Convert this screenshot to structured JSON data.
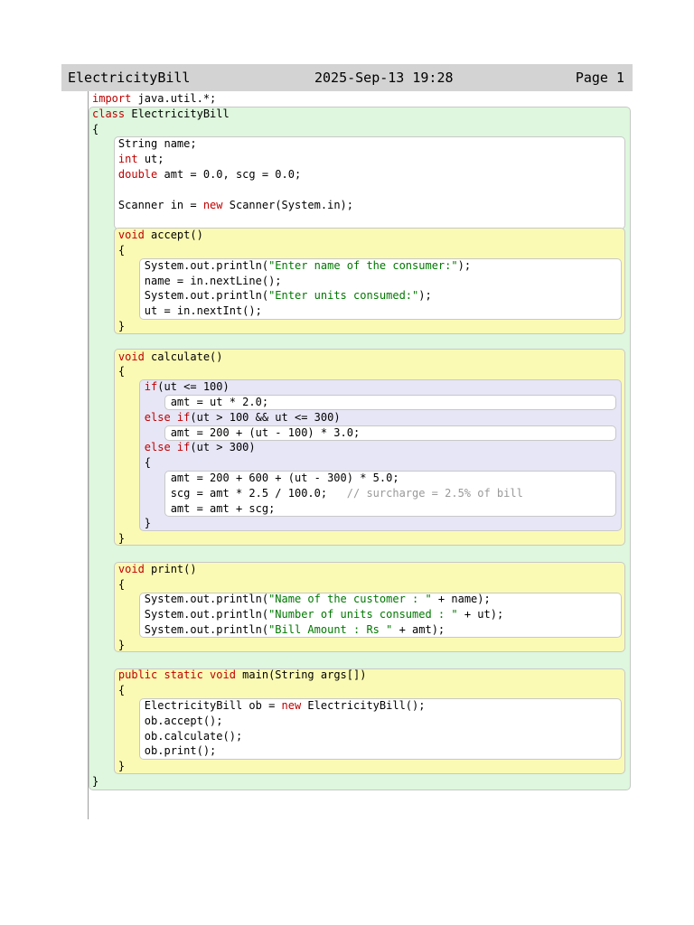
{
  "header": {
    "title": "ElectricityBill",
    "datetime": "2025-Sep-13 19:28",
    "page": "Page 1"
  },
  "code_lines": [
    [
      {
        "t": "import",
        "k": "kw"
      },
      {
        "t": " java.util.*;"
      }
    ],
    [
      {
        "t": "class",
        "k": "kw"
      },
      {
        "t": " ElectricityBill"
      }
    ],
    [
      {
        "t": "{"
      }
    ],
    [
      {
        "t": "    String name;"
      }
    ],
    [
      {
        "t": "    "
      },
      {
        "t": "int",
        "k": "kw"
      },
      {
        "t": " ut;"
      }
    ],
    [
      {
        "t": "    "
      },
      {
        "t": "double",
        "k": "kw"
      },
      {
        "t": " amt = 0.0, scg = 0.0;"
      }
    ],
    [
      {
        "t": ""
      }
    ],
    [
      {
        "t": "    Scanner in = "
      },
      {
        "t": "new",
        "k": "kw"
      },
      {
        "t": " Scanner(System.in);"
      }
    ],
    [
      {
        "t": ""
      }
    ],
    [
      {
        "t": "    "
      },
      {
        "t": "void",
        "k": "kw"
      },
      {
        "t": " accept()"
      }
    ],
    [
      {
        "t": "    {"
      }
    ],
    [
      {
        "t": "        System.out.println("
      },
      {
        "t": "\"Enter name of the consumer:\"",
        "k": "str"
      },
      {
        "t": ");"
      }
    ],
    [
      {
        "t": "        name = in.nextLine();"
      }
    ],
    [
      {
        "t": "        System.out.println("
      },
      {
        "t": "\"Enter units consumed:\"",
        "k": "str"
      },
      {
        "t": ");"
      }
    ],
    [
      {
        "t": "        ut = in.nextInt();"
      }
    ],
    [
      {
        "t": "    }"
      }
    ],
    [
      {
        "t": ""
      }
    ],
    [
      {
        "t": "    "
      },
      {
        "t": "void",
        "k": "kw"
      },
      {
        "t": " calculate()"
      }
    ],
    [
      {
        "t": "    {"
      }
    ],
    [
      {
        "t": "        "
      },
      {
        "t": "if",
        "k": "kw"
      },
      {
        "t": "(ut <= 100)"
      }
    ],
    [
      {
        "t": "            amt = ut * 2.0;"
      }
    ],
    [
      {
        "t": "        "
      },
      {
        "t": "else if",
        "k": "kw"
      },
      {
        "t": "(ut > 100 && ut <= 300)"
      }
    ],
    [
      {
        "t": "            amt = 200 + (ut - 100) * 3.0;"
      }
    ],
    [
      {
        "t": "        "
      },
      {
        "t": "else if",
        "k": "kw"
      },
      {
        "t": "(ut > 300)"
      }
    ],
    [
      {
        "t": "        {"
      }
    ],
    [
      {
        "t": "            amt = 200 + 600 + (ut - 300) * 5.0;"
      }
    ],
    [
      {
        "t": "            scg = amt * 2.5 / 100.0;   "
      },
      {
        "t": "// surcharge = 2.5% of bill",
        "k": "cmt"
      }
    ],
    [
      {
        "t": "            amt = amt + scg;"
      }
    ],
    [
      {
        "t": "        }"
      }
    ],
    [
      {
        "t": "    }"
      }
    ],
    [
      {
        "t": ""
      }
    ],
    [
      {
        "t": "    "
      },
      {
        "t": "void",
        "k": "kw"
      },
      {
        "t": " print()"
      }
    ],
    [
      {
        "t": "    {"
      }
    ],
    [
      {
        "t": "        System.out.println("
      },
      {
        "t": "\"Name of the customer : \"",
        "k": "str"
      },
      {
        "t": " + name);"
      }
    ],
    [
      {
        "t": "        System.out.println("
      },
      {
        "t": "\"Number of units consumed : \"",
        "k": "str"
      },
      {
        "t": " + ut);"
      }
    ],
    [
      {
        "t": "        System.out.println("
      },
      {
        "t": "\"Bill Amount : Rs \"",
        "k": "str"
      },
      {
        "t": " + amt);"
      }
    ],
    [
      {
        "t": "    }"
      }
    ],
    [
      {
        "t": ""
      }
    ],
    [
      {
        "t": "    "
      },
      {
        "t": "public static void",
        "k": "kw"
      },
      {
        "t": " main(String args[])"
      }
    ],
    [
      {
        "t": "    {"
      }
    ],
    [
      {
        "t": "        ElectricityBill ob = "
      },
      {
        "t": "new",
        "k": "kw"
      },
      {
        "t": " ElectricityBill();"
      }
    ],
    [
      {
        "t": "        ob.accept();"
      }
    ],
    [
      {
        "t": "        ob.calculate();"
      }
    ],
    [
      {
        "t": "        ob.print();"
      }
    ],
    [
      {
        "t": "    }"
      }
    ],
    [
      {
        "t": "}"
      }
    ]
  ],
  "colors": {
    "header_bg": "#d3d3d3",
    "keyword": "#c00000",
    "string": "#007800",
    "comment": "#999999",
    "class_block": "#def7de",
    "method_block": "#fafab4",
    "if_block": "#e6e6f6",
    "body_block": "#ffffff"
  }
}
